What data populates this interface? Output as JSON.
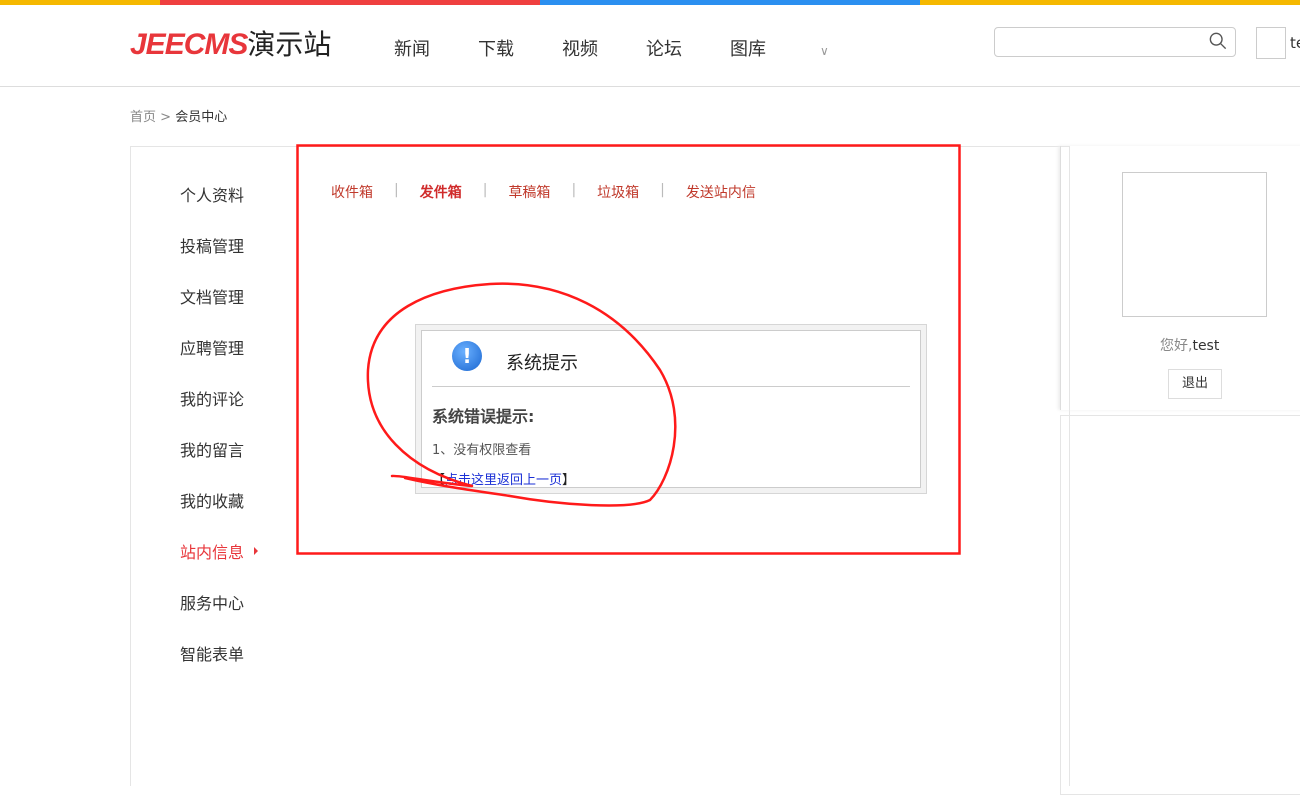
{
  "colors": {
    "bar": [
      "#f5b800",
      "#ef3f3f",
      "#2b8ff0",
      "#f5b800"
    ],
    "brand": "#e8363b",
    "annotation": "#ff1a1a"
  },
  "header": {
    "brand": "JEECMS",
    "site": "演示站",
    "nav": [
      "新闻",
      "下载",
      "视频",
      "论坛",
      "图库"
    ],
    "search_placeholder": "",
    "username_partial": "te"
  },
  "breadcrumb": {
    "home": "首页",
    "sep": ">",
    "current": "会员中心"
  },
  "sidebar": {
    "items": [
      "个人资料",
      "投稿管理",
      "文档管理",
      "应聘管理",
      "我的评论",
      "我的留言",
      "我的收藏",
      "站内信息",
      "服务中心",
      "智能表单"
    ],
    "active": "站内信息"
  },
  "tabs": {
    "items": [
      "收件箱",
      "发件箱",
      "草稿箱",
      "垃圾箱",
      "发送站内信"
    ],
    "sep": "|",
    "active": "发件箱"
  },
  "message": {
    "title": "系统提示",
    "heading": "系统错误提示:",
    "line": "1、没有权限查看",
    "back_open": "【",
    "back_link": "点击这里返回上一页",
    "back_close": "】"
  },
  "user": {
    "greeting": "您好,",
    "name": "test",
    "logout": "退出"
  }
}
